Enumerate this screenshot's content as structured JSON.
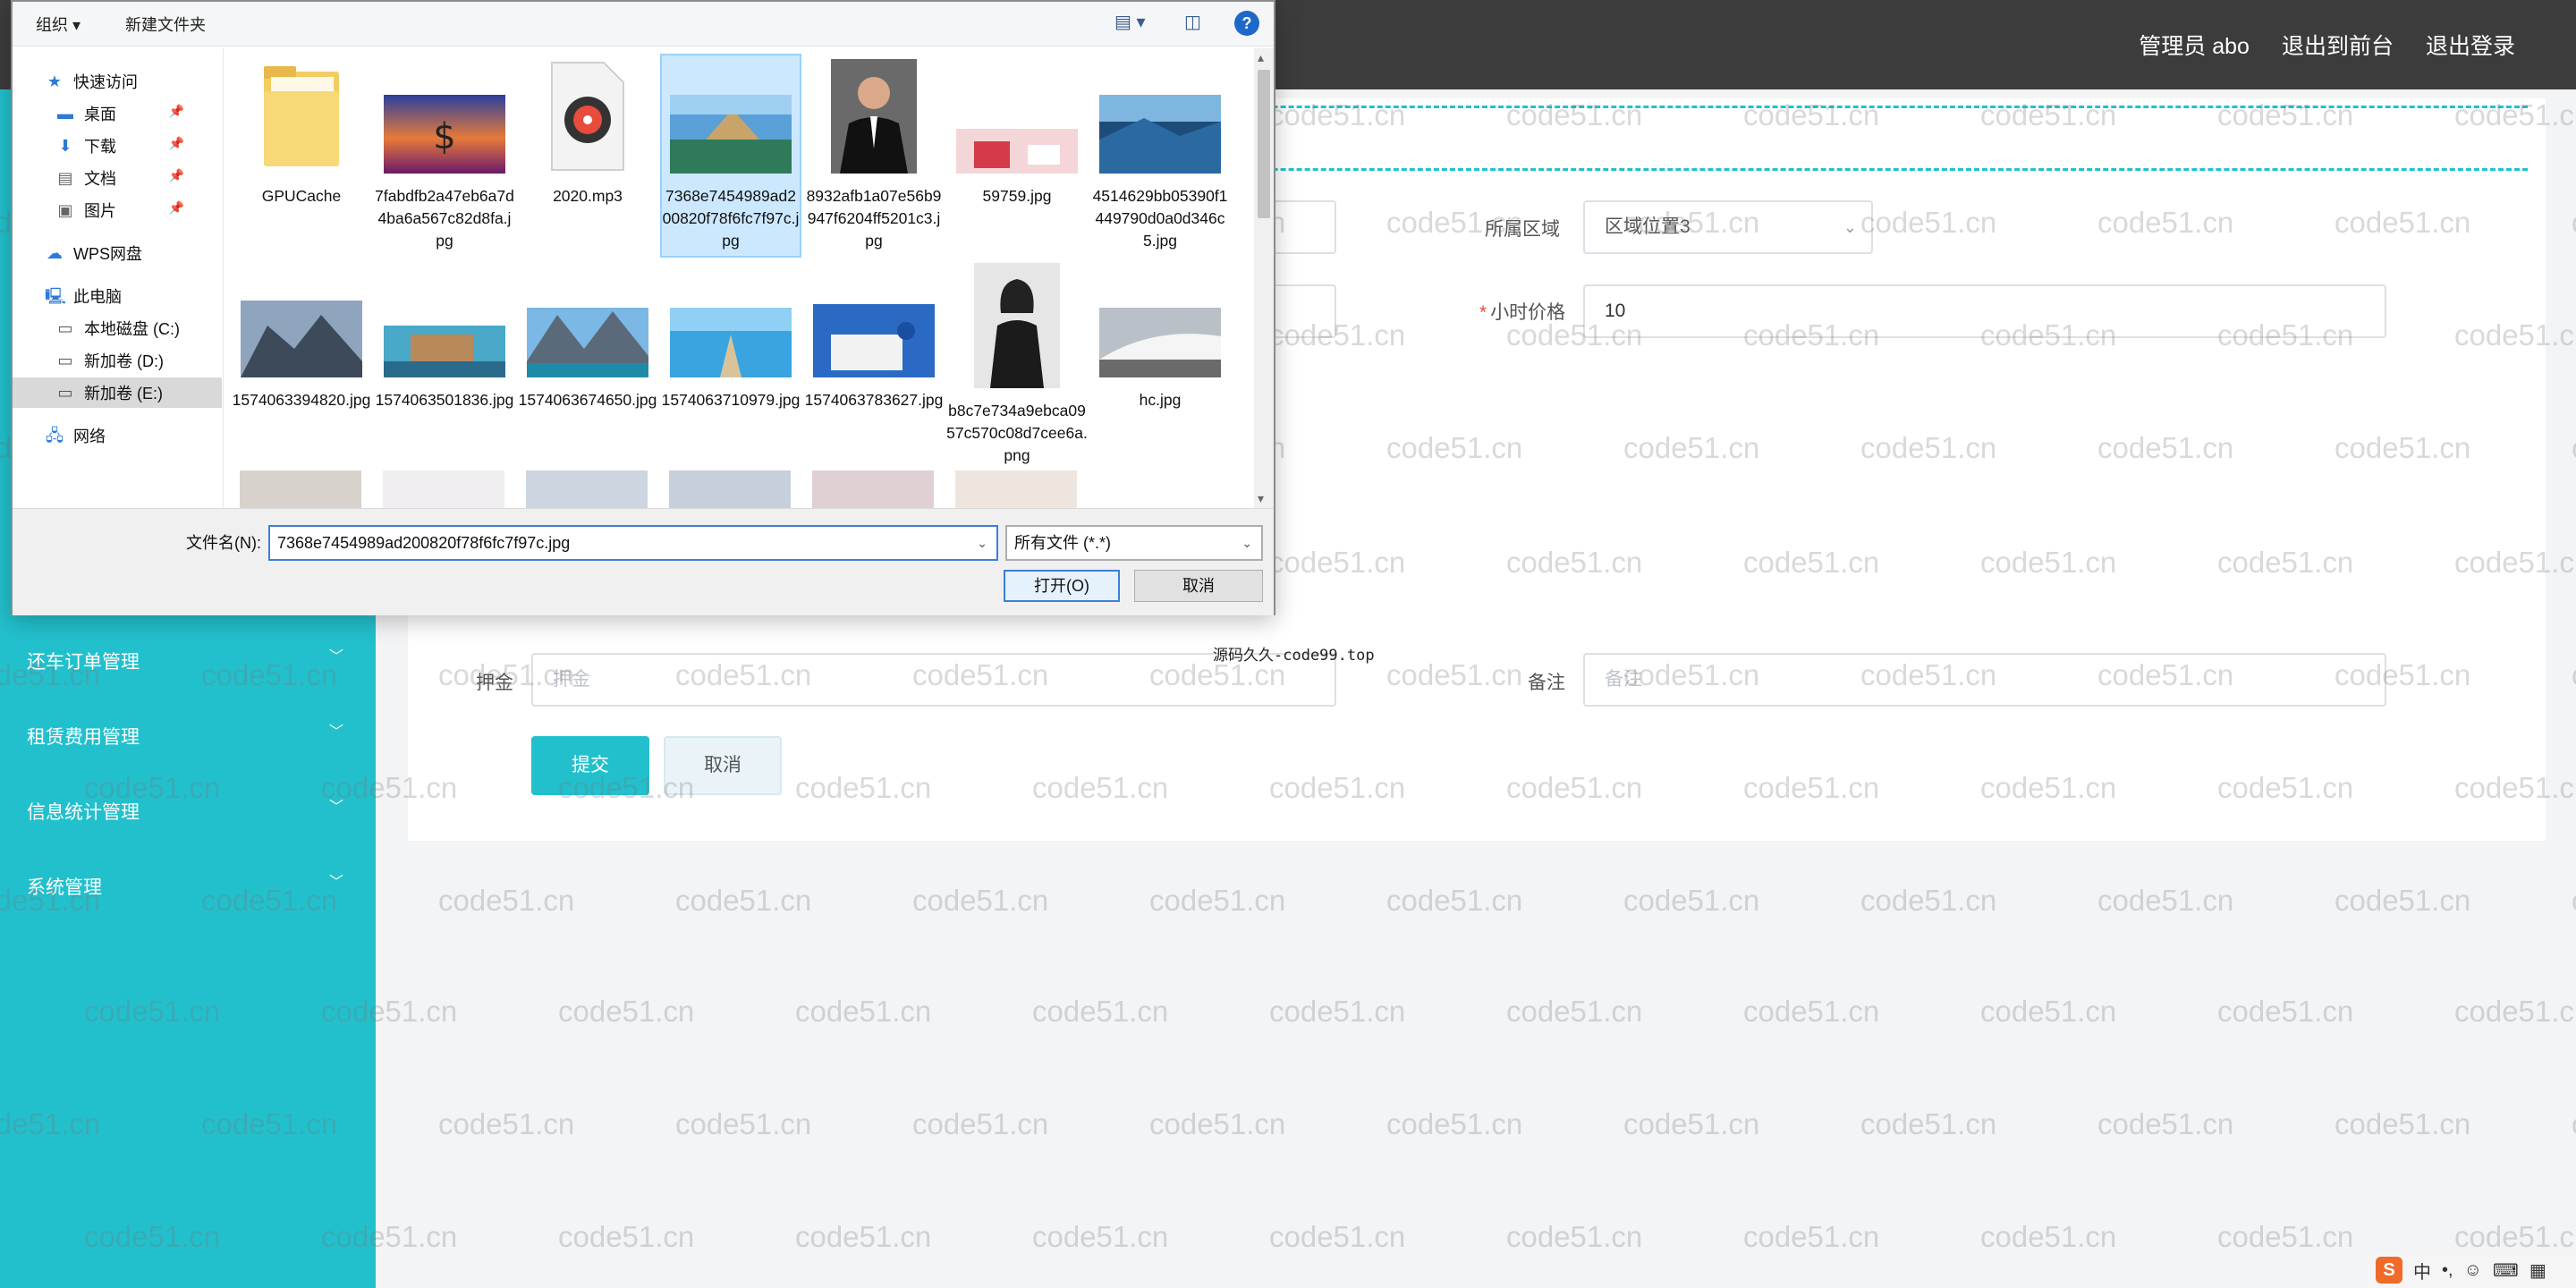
{
  "topbar": {
    "admin_label": "管理员 abo",
    "to_frontend": "退出到前台",
    "logout": "退出登录"
  },
  "sidebar": {
    "items": [
      {
        "label": "还车订单管理"
      },
      {
        "label": "租赁费用管理"
      },
      {
        "label": "信息统计管理"
      },
      {
        "label": "系统管理"
      }
    ],
    "chevron": "﹀"
  },
  "form": {
    "region_label": "所属区域",
    "region_value": "区域位置3",
    "hourly_label": "小时价格",
    "hourly_value": "10",
    "required_mark": "*",
    "deposit_label": "押金",
    "deposit_placeholder": "押金",
    "remark_label": "备注",
    "remark_placeholder": "备注",
    "submit": "提交",
    "cancel": "取消"
  },
  "site_note": "源码久久-code99.top",
  "watermark_text": "code51.cn",
  "tray": {
    "ime": "S",
    "lang": "中",
    "punct": "•,"
  },
  "dialog": {
    "toolbar": {
      "organize": "组织 ▾",
      "new_folder": "新建文件夹",
      "help": "?"
    },
    "nav": {
      "quick_access": "快速访问",
      "desktop": "桌面",
      "downloads": "下载",
      "documents": "文档",
      "pictures": "图片",
      "wps": "WPS网盘",
      "this_pc": "此电脑",
      "drive_c": "本地磁盘 (C:)",
      "drive_d": "新加卷 (D:)",
      "drive_e": "新加卷 (E:)",
      "network": "网络"
    },
    "files": [
      {
        "name": "GPUCache"
      },
      {
        "name": "7fabdfb2a47eb6a7d4ba6a567c82d8fa.jpg"
      },
      {
        "name": "2020.mp3"
      },
      {
        "name": "7368e7454989ad200820f78f6fc7f97c.jpg"
      },
      {
        "name": "8932afb1a07e56b9947f6204ff5201c3.jpg"
      },
      {
        "name": "59759.jpg"
      },
      {
        "name": "4514629bb05390f1449790d0a0d346c5.jpg"
      },
      {
        "name": "1574063394820.jpg"
      },
      {
        "name": "1574063501836.jpg"
      },
      {
        "name": "1574063674650.jpg"
      },
      {
        "name": "1574063710979.jpg"
      },
      {
        "name": "1574063783627.jpg"
      },
      {
        "name": "b8c7e734a9ebca0957c570c08d7cee6a.png"
      },
      {
        "name": "hc.jpg"
      }
    ],
    "filename_label": "文件名(N):",
    "filename_value": "7368e7454989ad200820f78f6fc7f97c.jpg",
    "filetype_value": "所有文件 (*.*)",
    "open_button": "打开(O)",
    "cancel_button": "取消"
  }
}
